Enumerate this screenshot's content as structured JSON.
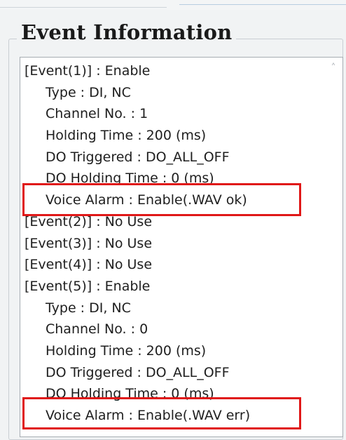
{
  "group": {
    "title": "Event Information"
  },
  "events": [
    {
      "header": "[Event(1)] : Enable",
      "details": [
        "Type : DI, NC",
        "Channel No. : 1",
        "Holding Time : 200 (ms)",
        "DO Triggered : DO_ALL_OFF",
        "DO Holding Time : 0 (ms)",
        "Voice Alarm : Enable(.WAV ok)"
      ]
    },
    {
      "header": "[Event(2)] : No Use",
      "details": []
    },
    {
      "header": "[Event(3)] : No Use",
      "details": []
    },
    {
      "header": "[Event(4)] : No Use",
      "details": []
    },
    {
      "header": "[Event(5)] : Enable",
      "details": [
        "Type : DI, NC",
        "Channel No. : 0",
        "Holding Time : 200 (ms)",
        "DO Triggered : DO_ALL_OFF",
        "DO Holding Time : 0 (ms)",
        "Voice Alarm : Enable(.WAV err)"
      ]
    }
  ],
  "scrollbar": {
    "up_icon": "chevron-up-icon"
  },
  "colors": {
    "highlight": "#e01818"
  }
}
